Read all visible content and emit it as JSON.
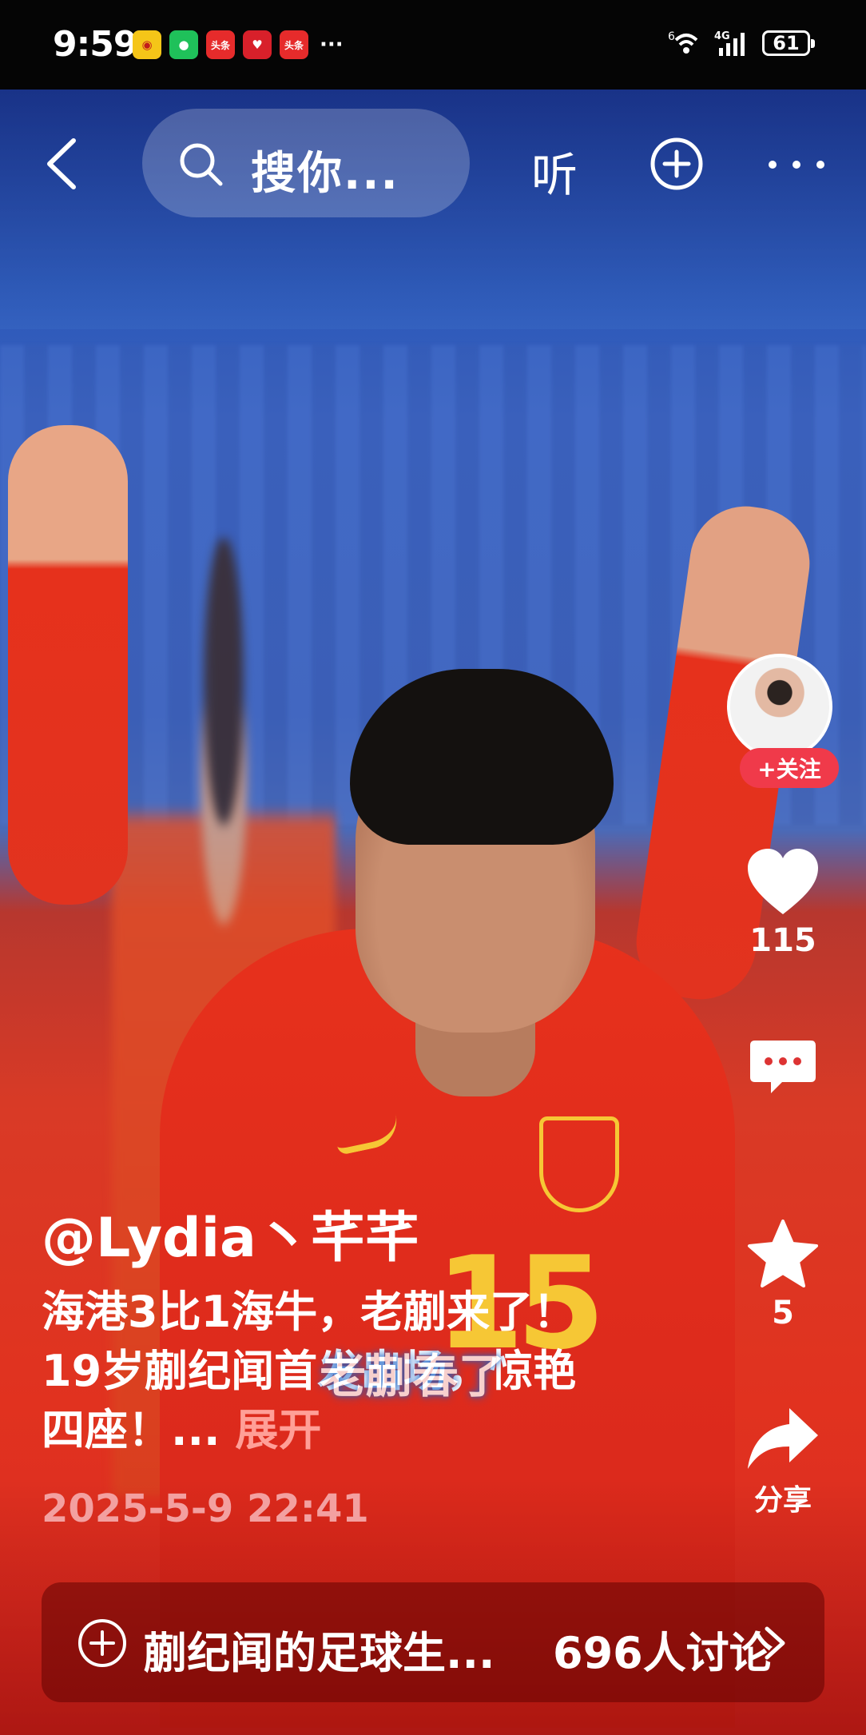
{
  "status_bar": {
    "time": "9:59",
    "notification_icons": [
      "weibo-icon",
      "wechat-icon",
      "toutiao-icon",
      "heart-app-icon",
      "toutiao-lite-icon"
    ],
    "notifications_more": "···",
    "network": "4G",
    "sim_slot": "6",
    "battery": "61"
  },
  "top_nav": {
    "search_placeholder": "搜你...",
    "listen_label": "听"
  },
  "actions": {
    "follow_label": "+关注",
    "like_count": "115",
    "favorite_count": "5",
    "share_label": "分享"
  },
  "post": {
    "author": "@Lydia丶芊芊",
    "description": "海港3比1海牛，老蒯来了！ 19岁蒯纪闻首发出场，惊艳四座！...",
    "expand_label": "展开",
    "timestamp": "2025-5-9 22:41",
    "video_subtitle": "老蒯春了"
  },
  "topic": {
    "title": "蒯纪闻的足球生...",
    "discussion_count": "696人讨论"
  },
  "colors": {
    "follow_red": "#f03a4a",
    "timestamp_pink": "#f3a0a0",
    "jersey_gold": "#f6c735"
  }
}
